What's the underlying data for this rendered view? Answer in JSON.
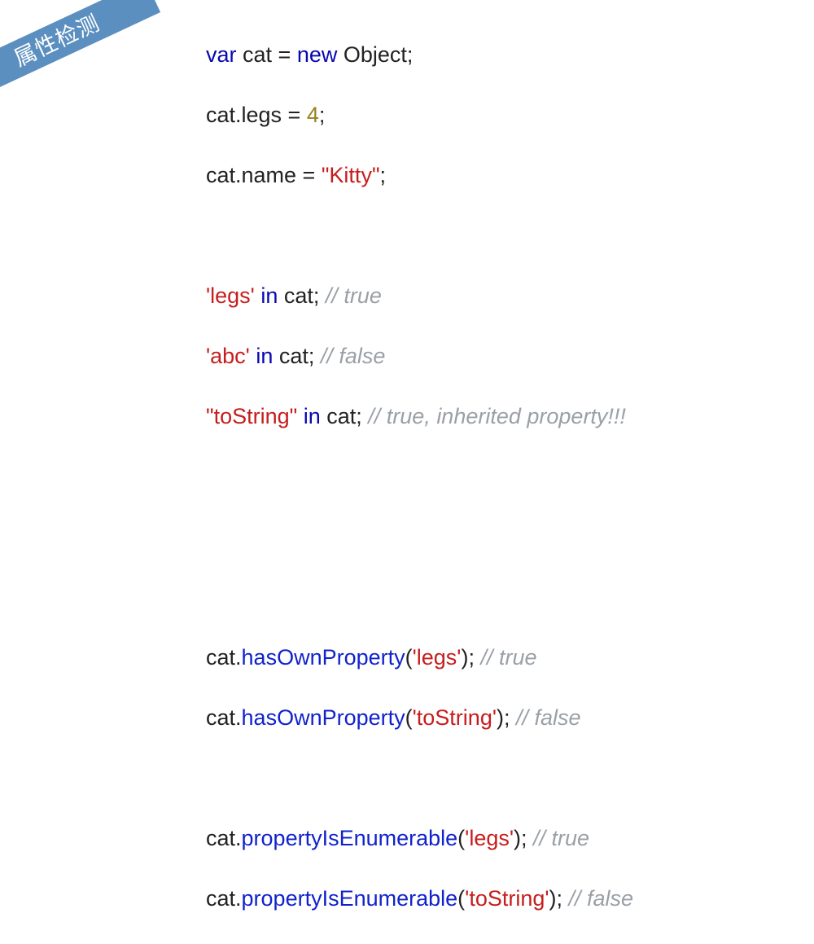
{
  "ribbon": {
    "label": "属性检测"
  },
  "code": {
    "l1": {
      "kw1": "var",
      "t1": " cat = ",
      "kw2": "new",
      "t2": " Object;"
    },
    "l2": {
      "t1": "cat.legs = ",
      "num": "4",
      "t2": ";"
    },
    "l3": {
      "t1": "cat.name = ",
      "str": "\"Kitty\"",
      "t2": ";"
    },
    "l4": {
      "str": "'legs'",
      "t1": " ",
      "kw": "in",
      "t2": " cat; ",
      "cmt": "// true"
    },
    "l5": {
      "str": "'abc'",
      "t1": " ",
      "kw": "in",
      "t2": " cat; ",
      "cmt": "// false"
    },
    "l6": {
      "str": "\"toString\"",
      "t1": " ",
      "kw": "in",
      "t2": " cat; ",
      "cmt": "// true, inherited property!!!"
    },
    "l7": {
      "t1": "cat.",
      "meth": "hasOwnProperty",
      "t2": "(",
      "str": "'legs'",
      "t3": "); ",
      "cmt": "// true"
    },
    "l8": {
      "t1": "cat.",
      "meth": "hasOwnProperty",
      "t2": "(",
      "str": "'toString'",
      "t3": "); ",
      "cmt": "// false"
    },
    "l9": {
      "t1": "cat.",
      "meth": "propertyIsEnumerable",
      "t2": "(",
      "str": "'legs'",
      "t3": "); ",
      "cmt": "// true"
    },
    "l10": {
      "t1": "cat.",
      "meth": "propertyIsEnumerable",
      "t2": "(",
      "str": "'toString'",
      "t3": "); ",
      "cmt": "// false"
    }
  }
}
